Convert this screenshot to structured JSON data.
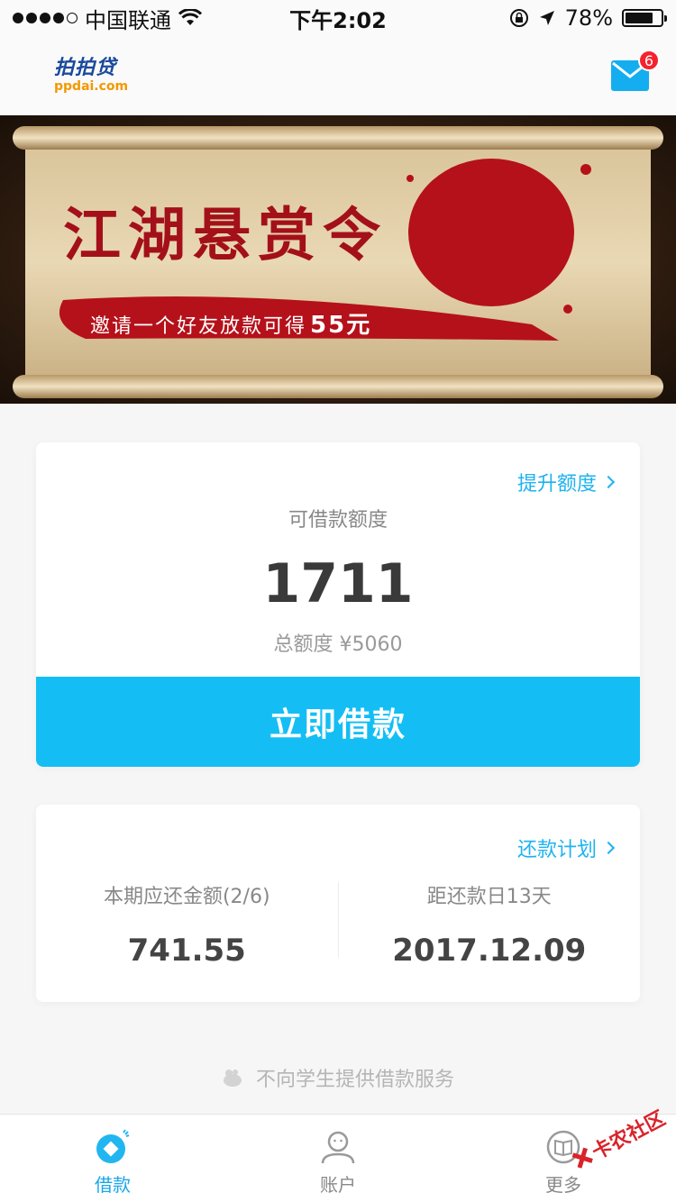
{
  "status_bar": {
    "carrier": "中国联通",
    "time": "下午2:02",
    "battery": "78%",
    "battery_level": 0.78
  },
  "header": {
    "logo_main": "拍拍贷",
    "logo_sub": "ppdai.com",
    "mail_badge": "6"
  },
  "banner": {
    "title": "江湖悬赏令",
    "subtitle_prefix": "邀请一个好友放款可得",
    "subtitle_amount": "55元"
  },
  "credit_card": {
    "raise_link": "提升额度",
    "available_label": "可借款额度",
    "available_value": "1711",
    "total_label": "总额度 ¥5060",
    "borrow_button": "立即借款"
  },
  "repay_card": {
    "plan_link": "还款计划",
    "current_label": "本期应还金额(2/6)",
    "current_value": "741.55",
    "due_label": "距还款日13天",
    "due_value": "2017.12.09"
  },
  "notice": "不向学生提供借款服务",
  "tabs": [
    {
      "label": "借款",
      "active": true
    },
    {
      "label": "账户",
      "active": false
    },
    {
      "label": "更多",
      "active": false
    }
  ],
  "watermark": "卡农社区",
  "colors": {
    "accent": "#14bef5",
    "link": "#1eb3f0",
    "badge": "#f5222d"
  }
}
